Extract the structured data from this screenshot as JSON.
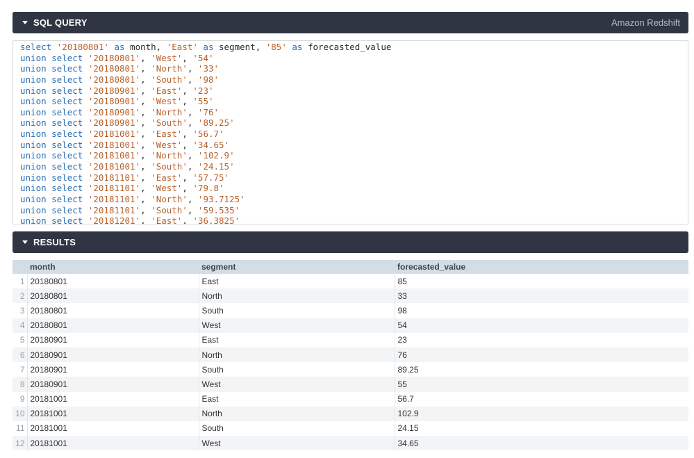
{
  "sql_panel": {
    "title": "SQL QUERY",
    "database": "Amazon Redshift"
  },
  "query_lines": [
    [
      {
        "t": "kw",
        "v": "select "
      },
      {
        "t": "str",
        "v": "'20180801'"
      },
      {
        "t": "kw",
        "v": " as"
      },
      {
        "t": "plain",
        "v": " month, "
      },
      {
        "t": "str",
        "v": "'East'"
      },
      {
        "t": "kw",
        "v": " as"
      },
      {
        "t": "plain",
        "v": " segment, "
      },
      {
        "t": "str",
        "v": "'85'"
      },
      {
        "t": "kw",
        "v": " as"
      },
      {
        "t": "plain",
        "v": " forecasted_value"
      }
    ],
    [
      {
        "t": "kw",
        "v": "union select "
      },
      {
        "t": "str",
        "v": "'20180801'"
      },
      {
        "t": "plain",
        "v": ", "
      },
      {
        "t": "str",
        "v": "'West'"
      },
      {
        "t": "plain",
        "v": ", "
      },
      {
        "t": "str",
        "v": "'54'"
      }
    ],
    [
      {
        "t": "kw",
        "v": "union select "
      },
      {
        "t": "str",
        "v": "'20180801'"
      },
      {
        "t": "plain",
        "v": ", "
      },
      {
        "t": "str",
        "v": "'North'"
      },
      {
        "t": "plain",
        "v": ", "
      },
      {
        "t": "str",
        "v": "'33'"
      }
    ],
    [
      {
        "t": "kw",
        "v": "union select "
      },
      {
        "t": "str",
        "v": "'20180801'"
      },
      {
        "t": "plain",
        "v": ", "
      },
      {
        "t": "str",
        "v": "'South'"
      },
      {
        "t": "plain",
        "v": ", "
      },
      {
        "t": "str",
        "v": "'98'"
      }
    ],
    [
      {
        "t": "kw",
        "v": "union select "
      },
      {
        "t": "str",
        "v": "'20180901'"
      },
      {
        "t": "plain",
        "v": ", "
      },
      {
        "t": "str",
        "v": "'East'"
      },
      {
        "t": "plain",
        "v": ", "
      },
      {
        "t": "str",
        "v": "'23'"
      }
    ],
    [
      {
        "t": "kw",
        "v": "union select "
      },
      {
        "t": "str",
        "v": "'20180901'"
      },
      {
        "t": "plain",
        "v": ", "
      },
      {
        "t": "str",
        "v": "'West'"
      },
      {
        "t": "plain",
        "v": ", "
      },
      {
        "t": "str",
        "v": "'55'"
      }
    ],
    [
      {
        "t": "kw",
        "v": "union select "
      },
      {
        "t": "str",
        "v": "'20180901'"
      },
      {
        "t": "plain",
        "v": ", "
      },
      {
        "t": "str",
        "v": "'North'"
      },
      {
        "t": "plain",
        "v": ", "
      },
      {
        "t": "str",
        "v": "'76'"
      }
    ],
    [
      {
        "t": "kw",
        "v": "union select "
      },
      {
        "t": "str",
        "v": "'20180901'"
      },
      {
        "t": "plain",
        "v": ", "
      },
      {
        "t": "str",
        "v": "'South'"
      },
      {
        "t": "plain",
        "v": ", "
      },
      {
        "t": "str",
        "v": "'89.25'"
      }
    ],
    [
      {
        "t": "kw",
        "v": "union select "
      },
      {
        "t": "str",
        "v": "'20181001'"
      },
      {
        "t": "plain",
        "v": ", "
      },
      {
        "t": "str",
        "v": "'East'"
      },
      {
        "t": "plain",
        "v": ", "
      },
      {
        "t": "str",
        "v": "'56.7'"
      }
    ],
    [
      {
        "t": "kw",
        "v": "union select "
      },
      {
        "t": "str",
        "v": "'20181001'"
      },
      {
        "t": "plain",
        "v": ", "
      },
      {
        "t": "str",
        "v": "'West'"
      },
      {
        "t": "plain",
        "v": ", "
      },
      {
        "t": "str",
        "v": "'34.65'"
      }
    ],
    [
      {
        "t": "kw",
        "v": "union select "
      },
      {
        "t": "str",
        "v": "'20181001'"
      },
      {
        "t": "plain",
        "v": ", "
      },
      {
        "t": "str",
        "v": "'North'"
      },
      {
        "t": "plain",
        "v": ", "
      },
      {
        "t": "str",
        "v": "'102.9'"
      }
    ],
    [
      {
        "t": "kw",
        "v": "union select "
      },
      {
        "t": "str",
        "v": "'20181001'"
      },
      {
        "t": "plain",
        "v": ", "
      },
      {
        "t": "str",
        "v": "'South'"
      },
      {
        "t": "plain",
        "v": ", "
      },
      {
        "t": "str",
        "v": "'24.15'"
      }
    ],
    [
      {
        "t": "kw",
        "v": "union select "
      },
      {
        "t": "str",
        "v": "'20181101'"
      },
      {
        "t": "plain",
        "v": ", "
      },
      {
        "t": "str",
        "v": "'East'"
      },
      {
        "t": "plain",
        "v": ", "
      },
      {
        "t": "str",
        "v": "'57.75'"
      }
    ],
    [
      {
        "t": "kw",
        "v": "union select "
      },
      {
        "t": "str",
        "v": "'20181101'"
      },
      {
        "t": "plain",
        "v": ", "
      },
      {
        "t": "str",
        "v": "'West'"
      },
      {
        "t": "plain",
        "v": ", "
      },
      {
        "t": "str",
        "v": "'79.8'"
      }
    ],
    [
      {
        "t": "kw",
        "v": "union select "
      },
      {
        "t": "str",
        "v": "'20181101'"
      },
      {
        "t": "plain",
        "v": ", "
      },
      {
        "t": "str",
        "v": "'North'"
      },
      {
        "t": "plain",
        "v": ", "
      },
      {
        "t": "str",
        "v": "'93.7125'"
      }
    ],
    [
      {
        "t": "kw",
        "v": "union select "
      },
      {
        "t": "str",
        "v": "'20181101'"
      },
      {
        "t": "plain",
        "v": ", "
      },
      {
        "t": "str",
        "v": "'South'"
      },
      {
        "t": "plain",
        "v": ", "
      },
      {
        "t": "str",
        "v": "'59.535'"
      }
    ],
    [
      {
        "t": "kw",
        "v": "union select "
      },
      {
        "t": "str",
        "v": "'20181201'"
      },
      {
        "t": "plain",
        "v": ", "
      },
      {
        "t": "str",
        "v": "'East'"
      },
      {
        "t": "plain",
        "v": ", "
      },
      {
        "t": "str",
        "v": "'36.3825'"
      }
    ]
  ],
  "results_panel": {
    "title": "RESULTS"
  },
  "results_table": {
    "columns": [
      "month",
      "segment",
      "forecasted_value"
    ],
    "rows": [
      {
        "idx": "1",
        "month": "20180801",
        "segment": "East",
        "forecasted_value": "85"
      },
      {
        "idx": "2",
        "month": "20180801",
        "segment": "North",
        "forecasted_value": "33"
      },
      {
        "idx": "3",
        "month": "20180801",
        "segment": "South",
        "forecasted_value": "98"
      },
      {
        "idx": "4",
        "month": "20180801",
        "segment": "West",
        "forecasted_value": "54"
      },
      {
        "idx": "5",
        "month": "20180901",
        "segment": "East",
        "forecasted_value": "23"
      },
      {
        "idx": "6",
        "month": "20180901",
        "segment": "North",
        "forecasted_value": "76"
      },
      {
        "idx": "7",
        "month": "20180901",
        "segment": "South",
        "forecasted_value": "89.25"
      },
      {
        "idx": "8",
        "month": "20180901",
        "segment": "West",
        "forecasted_value": "55"
      },
      {
        "idx": "9",
        "month": "20181001",
        "segment": "East",
        "forecasted_value": "56.7"
      },
      {
        "idx": "10",
        "month": "20181001",
        "segment": "North",
        "forecasted_value": "102.9"
      },
      {
        "idx": "11",
        "month": "20181001",
        "segment": "South",
        "forecasted_value": "24.15"
      },
      {
        "idx": "12",
        "month": "20181001",
        "segment": "West",
        "forecasted_value": "34.65"
      }
    ]
  },
  "colors": {
    "header_bg": "#2f3542",
    "keyword": "#2b6fb3",
    "string": "#b8622b",
    "table_header_bg": "#d4dde6",
    "row_stripe": "#f2f4f6"
  },
  "icons": {
    "collapse": "caret-down-icon"
  }
}
